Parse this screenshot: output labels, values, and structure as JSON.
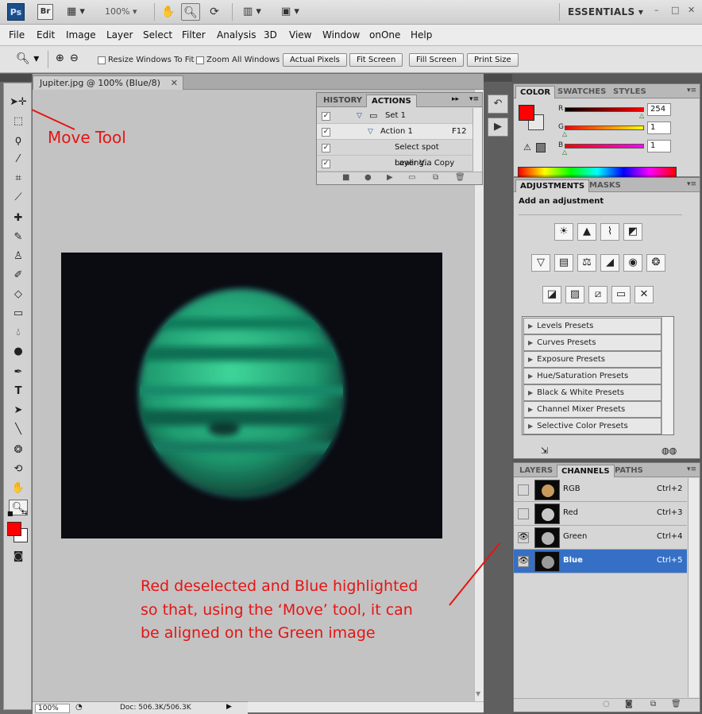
{
  "app": {
    "logo": "Ps",
    "bridge": "Br",
    "zoom": "100%",
    "workspace": "ESSENTIALS",
    "window_controls": [
      "–",
      "□",
      "✕"
    ]
  },
  "menu": [
    "File",
    "Edit",
    "Image",
    "Layer",
    "Select",
    "Filter",
    "Analysis",
    "3D",
    "View",
    "Window",
    "onOne",
    "Help"
  ],
  "options": {
    "resize_windows": "Resize Windows To Fit",
    "zoom_all": "Zoom All Windows",
    "buttons": [
      "Actual Pixels",
      "Fit Screen",
      "Fill Screen",
      "Print Size"
    ]
  },
  "document": {
    "tab_title": "Jupiter.jpg @ 100% (Blue/8)",
    "close": "✕",
    "status_zoom": "100%",
    "status_doc": "Doc: 506.3K/506.3K"
  },
  "actions_panel": {
    "tabs": [
      "HISTORY",
      "ACTIONS"
    ],
    "rows": [
      "Set 1",
      "Action 1",
      "Select spot healing...",
      "Layer Via Copy"
    ],
    "action_key": "F12"
  },
  "color_panel": {
    "tabs": [
      "COLOR",
      "SWATCHES",
      "STYLES"
    ],
    "labels": [
      "R",
      "G",
      "B"
    ],
    "values": [
      "254",
      "1",
      "1"
    ],
    "fg_color": "#ff0000"
  },
  "adjustments_panel": {
    "tabs": [
      "ADJUSTMENTS",
      "MASKS"
    ],
    "heading": "Add an adjustment",
    "presets": [
      "Levels Presets",
      "Curves Presets",
      "Exposure Presets",
      "Hue/Saturation Presets",
      "Black & White Presets",
      "Channel Mixer Presets",
      "Selective Color Presets"
    ]
  },
  "channels_panel": {
    "tabs": [
      "LAYERS",
      "CHANNELS",
      "PATHS"
    ],
    "channels": [
      {
        "name": "RGB",
        "shortcut": "Ctrl+2"
      },
      {
        "name": "Red",
        "shortcut": "Ctrl+3"
      },
      {
        "name": "Green",
        "shortcut": "Ctrl+4"
      },
      {
        "name": "Blue",
        "shortcut": "Ctrl+5"
      }
    ]
  },
  "annotations": {
    "move_tool": "Move Tool",
    "line1": "Red deselected and Blue highlighted",
    "line2": "so that, using the ‘Move’ tool, it can",
    "line3": "be aligned on the Green image"
  }
}
